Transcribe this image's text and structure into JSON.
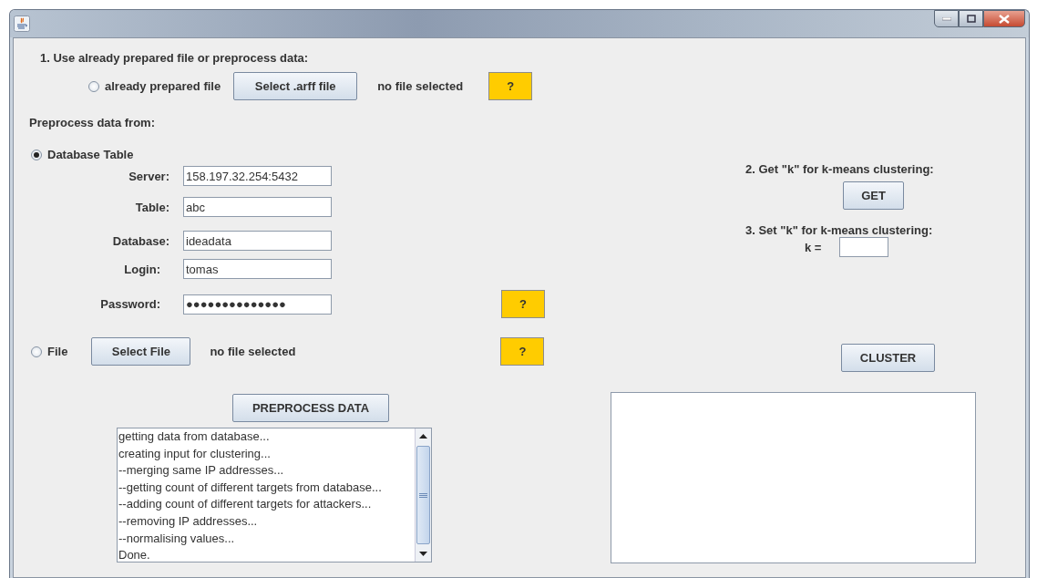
{
  "step1": {
    "heading": "1. Use already prepared file or preprocess data:",
    "option": {
      "label": "already prepared file",
      "selected": false
    },
    "button": "Select .arff file",
    "status": "no file selected",
    "help": "?"
  },
  "preprocess": {
    "heading": "Preprocess data from:",
    "database": {
      "label": "Database Table",
      "selected": true,
      "fields": [
        {
          "label": "Server:",
          "value": "158.197.32.254:5432"
        },
        {
          "label": "Table:",
          "value": "abc"
        },
        {
          "label": "Database:",
          "value": "ideadata"
        },
        {
          "label": "Login:",
          "value": "tomas"
        },
        {
          "label": "Password:",
          "value": "●●●●●●●●●●●●●●"
        }
      ],
      "help": "?"
    },
    "file": {
      "label": "File",
      "selected": false,
      "button": "Select File",
      "status": "no file selected",
      "help": "?"
    },
    "button": "PREPROCESS DATA",
    "log": [
      "getting data from database...",
      "creating input for clustering...",
      "--merging same IP addresses...",
      "--getting count of different targets from database...",
      "--adding count of different targets for attackers...",
      "--removing IP addresses...",
      "--normalising values...",
      "Done."
    ]
  },
  "step2": {
    "heading": "2. Get \"k\" for k-means clustering:",
    "button": "GET"
  },
  "step3": {
    "heading": "3. Set \"k\" for k-means clustering:",
    "k_label": "k ="
  },
  "cluster_button": "CLUSTER"
}
